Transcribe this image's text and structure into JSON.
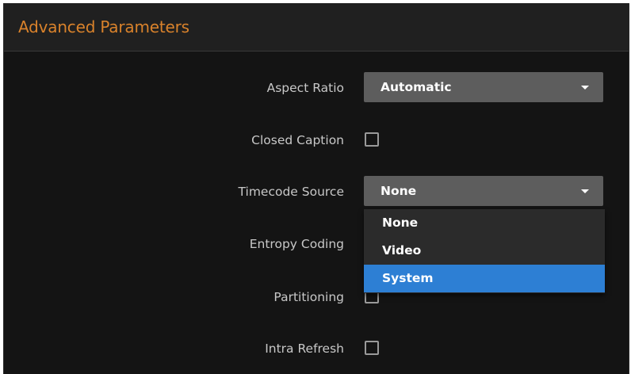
{
  "panel": {
    "title": "Advanced Parameters"
  },
  "fields": {
    "aspect_ratio": {
      "label": "Aspect Ratio",
      "value": "Automatic"
    },
    "closed_caption": {
      "label": "Closed Caption",
      "checked": false
    },
    "timecode_source": {
      "label": "Timecode Source",
      "value": "None"
    },
    "entropy_coding": {
      "label": "Entropy Coding"
    },
    "partitioning": {
      "label": "Partitioning",
      "checked": false
    },
    "intra_refresh": {
      "label": "Intra Refresh",
      "checked": false
    }
  },
  "timecode_dropdown": {
    "open": true,
    "options": [
      "None",
      "Video",
      "System"
    ],
    "highlighted": "System"
  },
  "colors": {
    "accent_title": "#d9822b",
    "highlight": "#2d7fd4",
    "background": "#141414",
    "select_bg": "#5d5d5d"
  }
}
